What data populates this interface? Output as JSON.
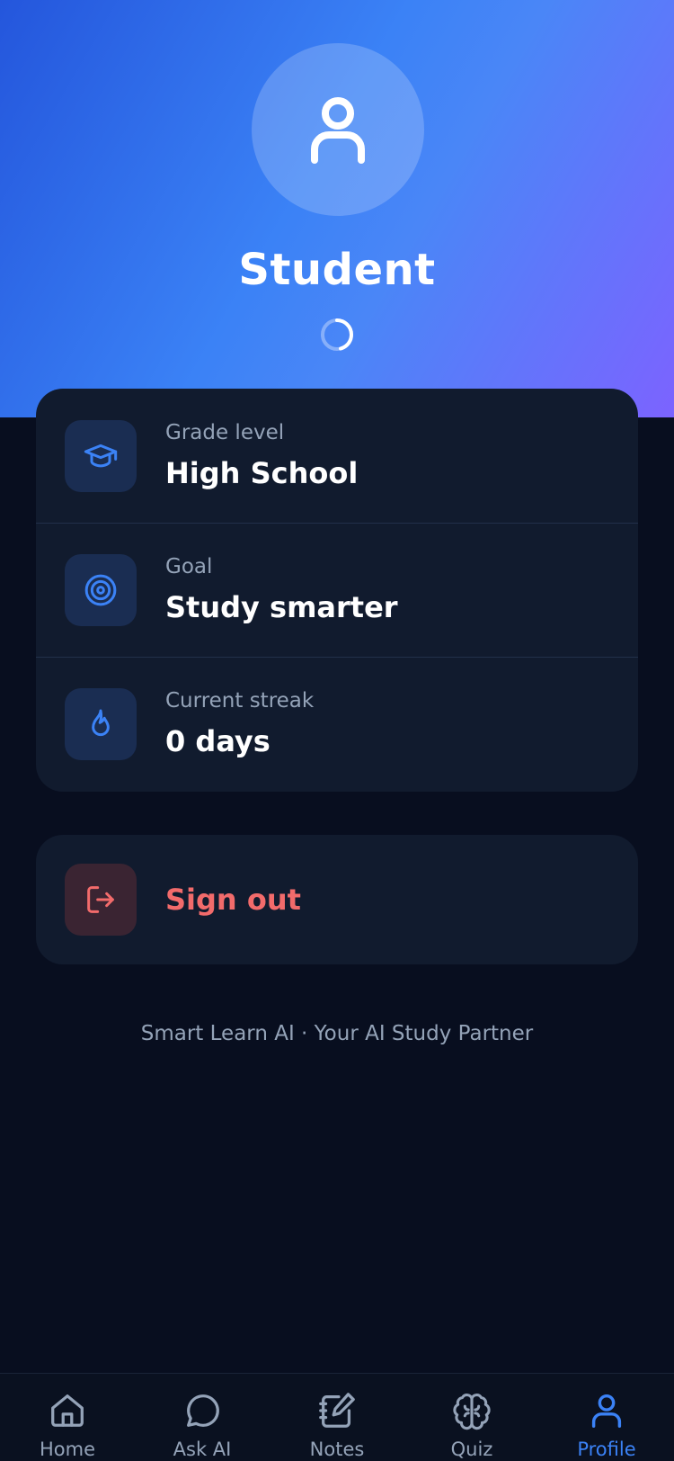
{
  "profile": {
    "name": "Student"
  },
  "details": [
    {
      "label": "Grade level",
      "value": "High School",
      "icon": "graduation-cap-icon"
    },
    {
      "label": "Goal",
      "value": "Study smarter",
      "icon": "target-icon"
    },
    {
      "label": "Current streak",
      "value": "0 days",
      "icon": "flame-icon"
    }
  ],
  "signout": {
    "label": "Sign out",
    "icon": "log-out-icon"
  },
  "footer": {
    "text": "Smart Learn AI · Your AI Study Partner"
  },
  "tabbar": {
    "tabs": [
      {
        "label": "Home",
        "icon": "home-icon",
        "active": false
      },
      {
        "label": "Ask AI",
        "icon": "chat-bubble-icon",
        "active": false
      },
      {
        "label": "Notes",
        "icon": "notebook-icon",
        "active": false
      },
      {
        "label": "Quiz",
        "icon": "brain-icon",
        "active": false
      },
      {
        "label": "Profile",
        "icon": "user-icon",
        "active": true
      }
    ]
  },
  "colors": {
    "accent": "#3b82f6",
    "danger": "#f26b6b",
    "background": "#080e1f",
    "card": "#111b2e",
    "muted_text": "#94a3b8"
  }
}
